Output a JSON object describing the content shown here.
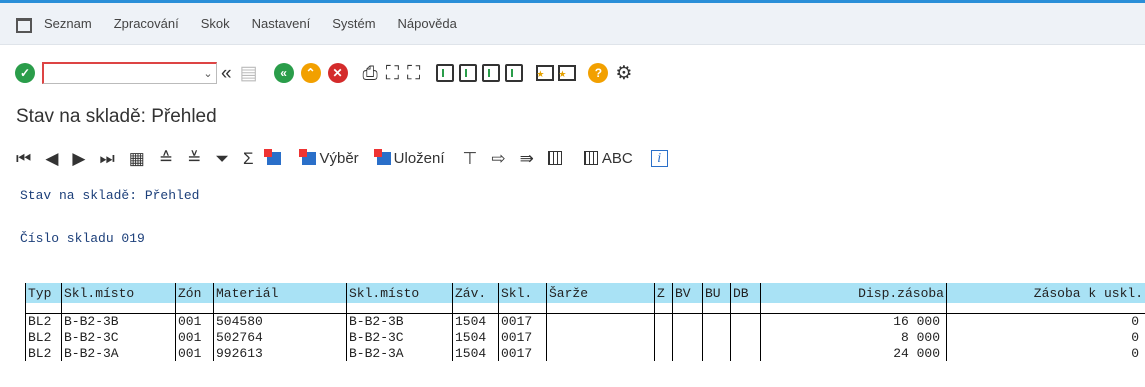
{
  "menu": {
    "items": [
      "Seznam",
      "Zpracování",
      "Skok",
      "Nastavení",
      "Systém",
      "Nápověda"
    ]
  },
  "toolbar": {
    "command_value": "",
    "icons": [
      "check-icon",
      "back-icon",
      "save-icon",
      "exit-icon",
      "up-icon",
      "cancel-icon",
      "print-icon",
      "find-icon",
      "find-next-icon",
      "first-page-icon",
      "prev-page-icon",
      "next-page-icon",
      "last-page-icon",
      "new-session-icon",
      "shortcut-icon",
      "help-icon",
      "settings-icon"
    ],
    "colors": {
      "check": "#2a9d4a",
      "exit": "#2a9d4a",
      "up": "#f2a000",
      "cancel": "#d42b2b",
      "help": "#f2a000"
    }
  },
  "page": {
    "title": "Stav na skladě: Přehled"
  },
  "alv": {
    "select_label": "Výběr",
    "save_label": "Uložení",
    "abc_label": "ABC"
  },
  "list": {
    "heading": "Stav na skladě: Přehled",
    "warehouse_line": "Číslo skladu 019"
  },
  "table": {
    "columns": [
      "Typ",
      "Skl.místo",
      "Zón",
      "Materiál",
      "Skl.místo",
      "Záv.",
      "Skl.",
      "Šarže",
      "Z",
      "BV",
      "BU",
      "DB",
      "Disp.zásoba",
      "Zásoba k uskl."
    ],
    "rows": [
      [
        "BL2",
        "B-B2-3B",
        "001",
        "504580",
        "B-B2-3B",
        "1504",
        "0017",
        "",
        "",
        "",
        "",
        "",
        "16 000",
        "0"
      ],
      [
        "BL2",
        "B-B2-3C",
        "001",
        "502764",
        "B-B2-3C",
        "1504",
        "0017",
        "",
        "",
        "",
        "",
        "",
        "8 000",
        "0"
      ],
      [
        "BL2",
        "B-B2-3A",
        "001",
        "992613",
        "B-B2-3A",
        "1504",
        "0017",
        "",
        "",
        "",
        "",
        "",
        "24 000",
        "0"
      ]
    ],
    "header_color": "#a9e2f5"
  }
}
